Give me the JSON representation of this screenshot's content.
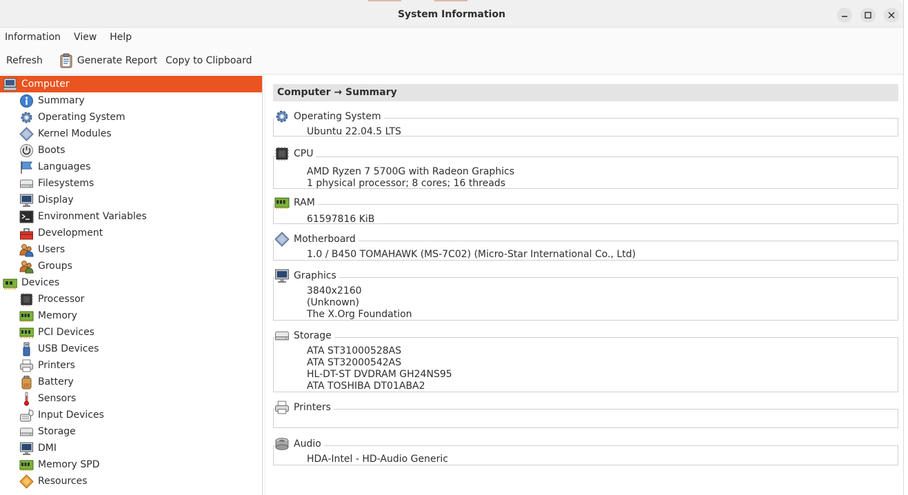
{
  "window": {
    "title": "System Information"
  },
  "menu": [
    "Information",
    "View",
    "Help"
  ],
  "toolbar": {
    "refresh": "Refresh",
    "generate_report": "Generate Report",
    "copy": "Copy to Clipboard"
  },
  "sidebar": {
    "items": [
      {
        "label": "Computer",
        "icon": "computer-icon"
      },
      {
        "label": "Summary",
        "icon": "info-icon"
      },
      {
        "label": "Operating System",
        "icon": "gear-icon"
      },
      {
        "label": "Kernel Modules",
        "icon": "diamond-icon"
      },
      {
        "label": "Boots",
        "icon": "power-icon"
      },
      {
        "label": "Languages",
        "icon": "flag-icon"
      },
      {
        "label": "Filesystems",
        "icon": "drive-icon"
      },
      {
        "label": "Display",
        "icon": "monitor-icon"
      },
      {
        "label": "Environment Variables",
        "icon": "terminal-icon"
      },
      {
        "label": "Development",
        "icon": "toolbox-icon"
      },
      {
        "label": "Users",
        "icon": "users-icon"
      },
      {
        "label": "Groups",
        "icon": "groups-icon"
      },
      {
        "label": "Devices",
        "icon": "board-icon"
      },
      {
        "label": "Processor",
        "icon": "chip-icon"
      },
      {
        "label": "Memory",
        "icon": "memory-icon"
      },
      {
        "label": "PCI Devices",
        "icon": "pci-icon"
      },
      {
        "label": "USB Devices",
        "icon": "usb-icon"
      },
      {
        "label": "Printers",
        "icon": "printer-icon"
      },
      {
        "label": "Battery",
        "icon": "battery-icon"
      },
      {
        "label": "Sensors",
        "icon": "thermometer-icon"
      },
      {
        "label": "Input Devices",
        "icon": "input-icon"
      },
      {
        "label": "Storage",
        "icon": "drive-icon"
      },
      {
        "label": "DMI",
        "icon": "monitor-icon"
      },
      {
        "label": "Memory SPD",
        "icon": "memory-icon"
      },
      {
        "label": "Resources",
        "icon": "resources-icon"
      }
    ]
  },
  "main": {
    "breadcrumb": "Computer → Summary",
    "sections": [
      {
        "label": "Operating System",
        "icon": "gear-icon",
        "lines": [
          "Ubuntu 22.04.5 LTS"
        ]
      },
      {
        "label": "CPU",
        "icon": "chip-icon",
        "lines": [
          "AMD Ryzen 7 5700G with Radeon Graphics",
          "1 physical processor; 8 cores; 16 threads"
        ]
      },
      {
        "label": "RAM",
        "icon": "memory-icon",
        "lines": [
          "61597816 KiB"
        ]
      },
      {
        "label": "Motherboard",
        "icon": "diamond-icon",
        "lines": [
          "1.0 / B450 TOMAHAWK (MS-7C02) (Micro-Star International Co., Ltd)"
        ]
      },
      {
        "label": "Graphics",
        "icon": "monitor-icon",
        "lines": [
          "3840x2160",
          "(Unknown)",
          "The X.Org Foundation"
        ]
      },
      {
        "label": "Storage",
        "icon": "drive-icon",
        "lines": [
          "ATA ST31000528AS",
          "ATA ST32000542AS",
          "HL-DT-ST DVDRAM GH24NS95",
          "ATA TOSHIBA DT01ABA2"
        ]
      },
      {
        "label": "Printers",
        "icon": "printer-icon",
        "lines": []
      },
      {
        "label": "Audio",
        "icon": "speaker-icon",
        "lines": [
          "HDA-Intel - HD-Audio Generic"
        ]
      }
    ]
  },
  "colors": {
    "accent": "#e95420",
    "breadcrumb_bg": "#e4e4e4"
  }
}
